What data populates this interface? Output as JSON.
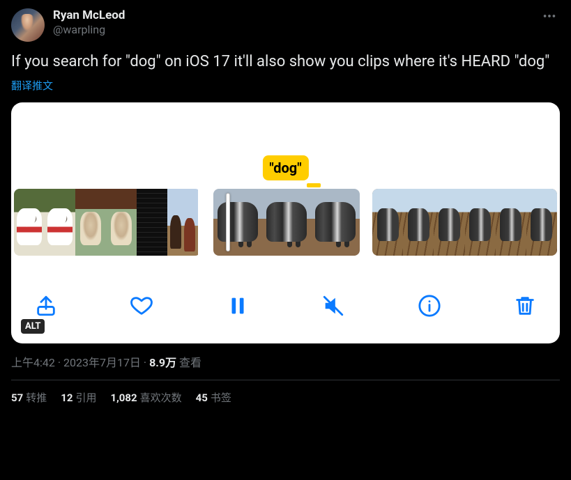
{
  "author": {
    "display_name": "Ryan McLeod",
    "handle": "@warpling"
  },
  "tweet_text": "If you search for \"dog\" on iOS 17 it'll also show you clips where it's HEARD \"dog\"",
  "translate_label": "翻译推文",
  "media": {
    "tag_text": "\"dog\"",
    "alt_badge": "ALT"
  },
  "meta": {
    "time": "上午4:42",
    "separator": " · ",
    "date": "2023年7月17日",
    "views_count": "8.9万",
    "views_label": " 查看"
  },
  "stats": {
    "retweets_count": "57",
    "retweets_label": "转推",
    "quotes_count": "12",
    "quotes_label": "引用",
    "likes_count": "1,082",
    "likes_label": "喜欢次数",
    "bookmarks_count": "45",
    "bookmarks_label": "书签"
  }
}
